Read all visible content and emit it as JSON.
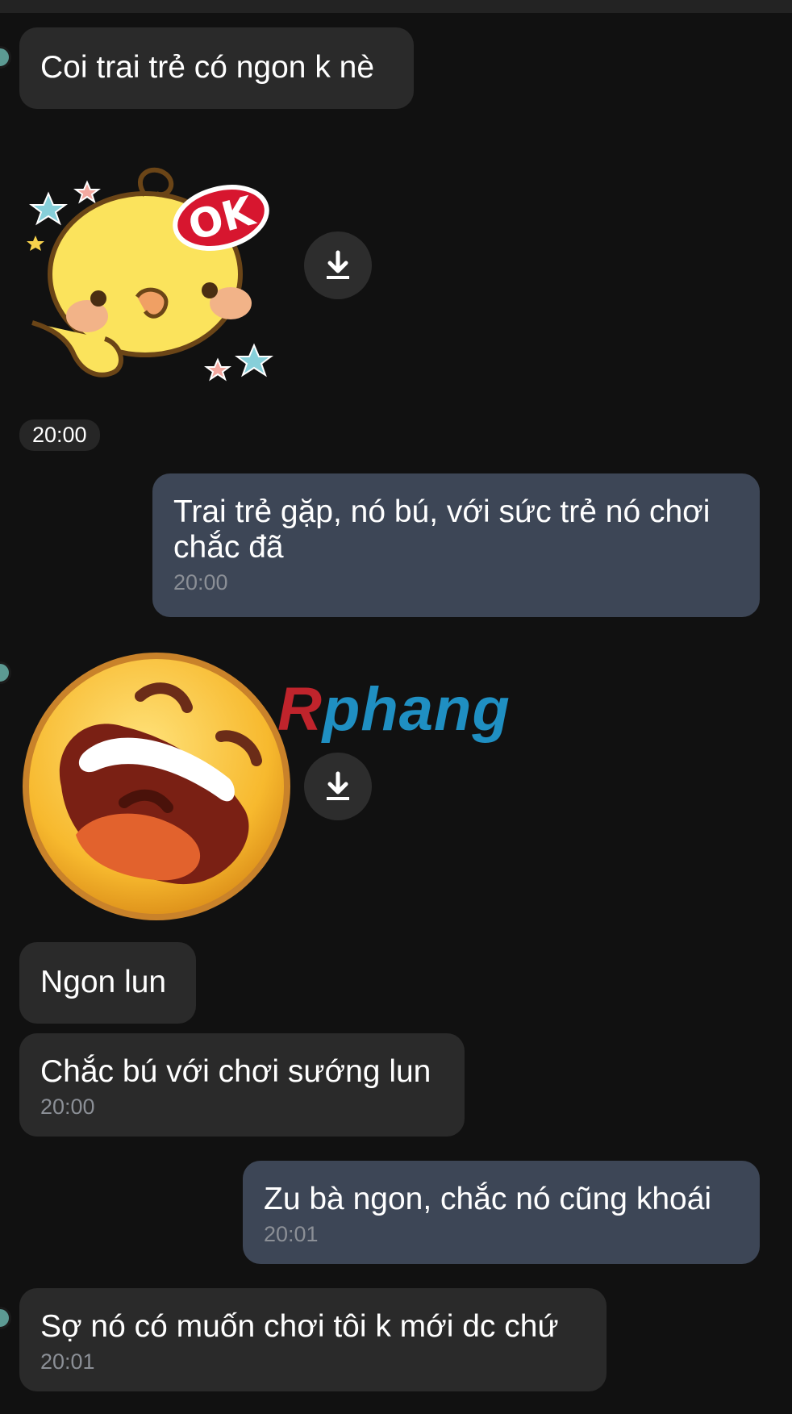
{
  "watermark": {
    "first_letter": "R",
    "rest": "phang"
  },
  "messages": [
    {
      "type": "received",
      "text": "Coi trai trẻ có ngon k nè"
    },
    {
      "type": "sticker",
      "icon": "duck-ok-sticker",
      "sticker_text": "OK"
    },
    {
      "type": "time-pill",
      "time": "20:00"
    },
    {
      "type": "sent",
      "text": "Trai trẻ gặp, nó bú, với sức trẻ nó chơi chắc đã",
      "time": "20:00"
    },
    {
      "type": "sticker",
      "icon": "laughing-emoji-sticker"
    },
    {
      "type": "received",
      "text": "Ngon lun"
    },
    {
      "type": "received",
      "text": "Chắc bú với chơi sướng lun",
      "time": "20:00"
    },
    {
      "type": "sent",
      "text": "Zu bà ngon, chắc nó cũng khoái",
      "time": "20:01"
    },
    {
      "type": "received",
      "text": "Sợ nó có muốn chơi tôi k mới dc chứ",
      "time": "20:01"
    }
  ],
  "icons": {
    "download": "download-icon",
    "avatar": "avatar"
  },
  "colors": {
    "background": "#111111",
    "received_bubble": "#2a2a2a",
    "sent_bubble": "#3d4656",
    "timestamp": "#8b8f96"
  }
}
